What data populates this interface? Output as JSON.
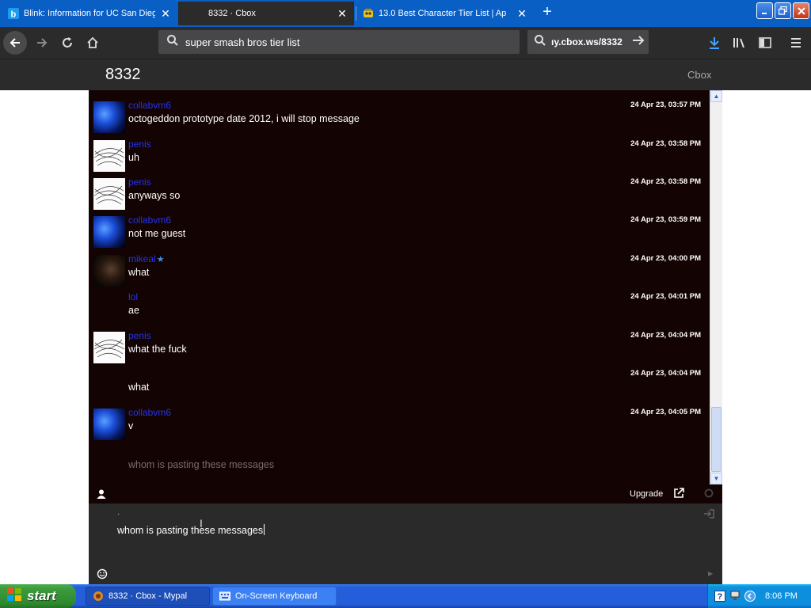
{
  "browser": {
    "tabs": [
      {
        "title": "Blink: Information for UC San Dieg",
        "active": false
      },
      {
        "title": "8332 · Cbox",
        "active": true
      },
      {
        "title": "13.0 Best Character Tier List | Ap",
        "active": false
      }
    ],
    "url_text": "super smash bros tier list",
    "search_text": "ıy.cbox.ws/8332"
  },
  "page": {
    "id": "8332",
    "brand": "Cbox"
  },
  "chat": {
    "messages": [
      {
        "user": "collabvm6",
        "text": "octogeddon prototype date 2012, i will stop message",
        "time": "24 Apr 23, 03:57 PM",
        "avatar": "blue"
      },
      {
        "user": "penis",
        "text": "uh",
        "time": "24 Apr 23, 03:58 PM",
        "avatar": "sketch"
      },
      {
        "user": "penis",
        "text": "anyways so",
        "time": "24 Apr 23, 03:58 PM",
        "avatar": "sketch"
      },
      {
        "user": "collabvm6",
        "text": "not me guest",
        "time": "24 Apr 23, 03:59 PM",
        "avatar": "blue"
      },
      {
        "user": "mikeal",
        "text": "what",
        "time": "24 Apr 23, 04:00 PM",
        "avatar": "dark",
        "starred": true
      },
      {
        "user": "lol",
        "text": "ae",
        "time": "24 Apr 23, 04:01 PM",
        "avatar": "none"
      },
      {
        "user": "penis",
        "text": "what the fuck",
        "time": "24 Apr 23, 04:04 PM",
        "avatar": "sketch"
      },
      {
        "user": "",
        "text": "what",
        "time": "24 Apr 23, 04:04 PM",
        "avatar": "none"
      },
      {
        "user": "collabvm6",
        "text": "v",
        "time": "24 Apr 23, 04:05 PM",
        "avatar": "blue"
      }
    ],
    "pending_text": "whom is pasting these messages",
    "upgrade_label": "Upgrade",
    "name_hint": "·",
    "input_value": "whom is pasting these messages"
  },
  "taskbar": {
    "start_label": "start",
    "items": [
      {
        "label": "8332 · Cbox - Mypal"
      },
      {
        "label": "On-Screen Keyboard"
      }
    ],
    "clock": "8:06 PM"
  },
  "colors": {
    "tab_strip": "#0a5fc4",
    "chrome_dark": "#2b2b2b",
    "chat_bg": "#140303",
    "username": "#2233ee",
    "taskbar": "#245edb"
  }
}
